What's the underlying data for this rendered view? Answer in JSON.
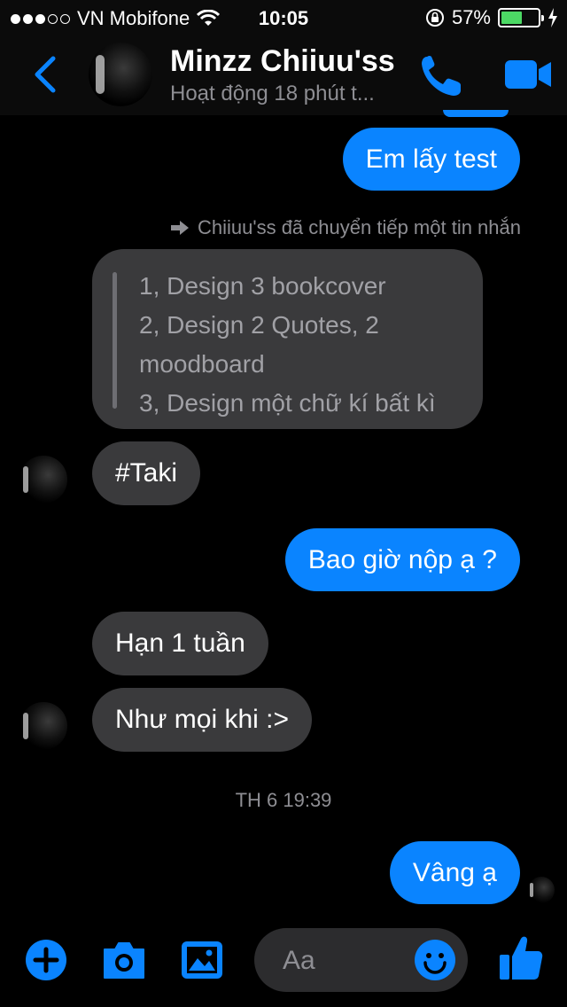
{
  "status_bar": {
    "carrier": "VN Mobifone",
    "time": "10:05",
    "battery_percent": "57%",
    "battery_level": 0.57
  },
  "header": {
    "back_icon": "chevron-left-icon",
    "contact_name": "Minzz Chiiuu'ss",
    "contact_status": "Hoạt động 18 phút t...",
    "call_icon": "phone-icon",
    "video_icon": "video-camera-icon"
  },
  "chat": {
    "msg_sent_1": "Em lấy test",
    "forward_notice": "Chiiuu'ss đã chuyển tiếp một tin nhắn",
    "forwarded_lines": [
      "1, Design 3 bookcover",
      "2, Design 2 Quotes, 2",
      "moodboard",
      "3, Design một chữ kí bất kì"
    ],
    "msg_recv_1": "#Taki",
    "msg_sent_2": "Bao giờ nộp ạ ?",
    "msg_recv_2": "Hạn 1 tuần",
    "msg_recv_3": "Như mọi khi :>",
    "timestamp": "TH 6 19:39",
    "msg_sent_3": "Vâng ạ"
  },
  "composer": {
    "placeholder": "Aa",
    "icons": [
      "plus-icon",
      "camera-icon",
      "gallery-icon",
      "emoji-icon",
      "thumbs-up-icon"
    ]
  },
  "colors": {
    "accent": "#0a84ff",
    "bubble_in": "#3a3a3c",
    "background": "#000000",
    "battery": "#4cd964"
  }
}
